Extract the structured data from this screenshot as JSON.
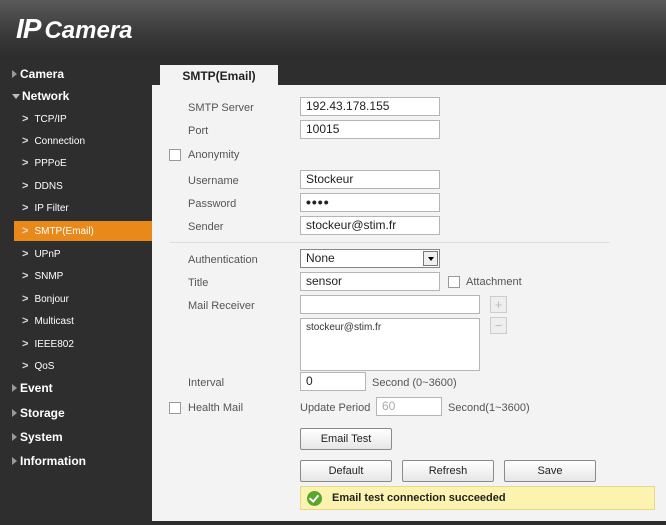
{
  "header": {
    "logo_ip": "IP",
    "logo_camera": "Camera"
  },
  "sidebar": {
    "camera": "Camera",
    "network": "Network",
    "items": [
      "TCP/IP",
      "Connection",
      "PPPoE",
      "DDNS",
      "IP Filter",
      "SMTP(Email)",
      "UPnP",
      "SNMP",
      "Bonjour",
      "Multicast",
      "IEEE802",
      "QoS"
    ],
    "active_item": "SMTP(Email)",
    "event": "Event",
    "storage": "Storage",
    "system": "System",
    "information": "Information"
  },
  "tab": {
    "label": "SMTP(Email)"
  },
  "form": {
    "smtp_server_label": "SMTP Server",
    "smtp_server": "192.43.178.155",
    "port_label": "Port",
    "port": "10015",
    "anonymity_label": "Anonymity",
    "anonymity_checked": false,
    "username_label": "Username",
    "username": "Stockeur",
    "password_label": "Password",
    "password": "••••",
    "sender_label": "Sender",
    "sender": "stockeur@stim.fr",
    "authentication_label": "Authentication",
    "authentication": "None",
    "title_label": "Title",
    "title": "sensor",
    "attachment_label": "Attachment",
    "attachment_checked": false,
    "mail_receiver_label": "Mail Receiver",
    "mail_receiver_input": "",
    "receivers": [
      "stockeur@stim.fr"
    ],
    "interval_label": "Interval",
    "interval": "0",
    "interval_range": "Second (0~3600)",
    "health_mail_label": "Health Mail",
    "health_mail_checked": false,
    "update_period_label": "Update Period",
    "update_period": "60",
    "update_period_range": "Second(1~3600)"
  },
  "buttons": {
    "email_test": "Email Test",
    "default": "Default",
    "refresh": "Refresh",
    "save": "Save"
  },
  "status": {
    "message": "Email test connection succeeded",
    "color": "#5aa52c"
  }
}
